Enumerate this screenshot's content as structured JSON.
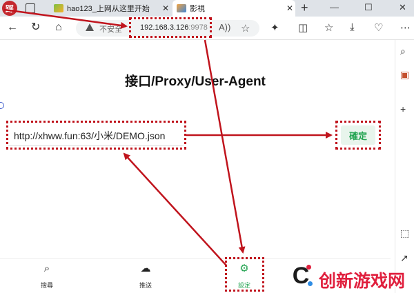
{
  "browser": {
    "tabs": [
      {
        "title": "hao123_上网从这里开始",
        "favicon": "hao123-icon"
      },
      {
        "title": "影視",
        "favicon": "tvbox-icon",
        "active": true
      }
    ],
    "profile_badge": "踩",
    "new_tab": "+",
    "window_controls": {
      "minimize": "—",
      "maximize": "☐",
      "close": "✕"
    },
    "address_bar": {
      "security_text": "不安全",
      "url_host": "192.168.3.126",
      "url_port": ":9978"
    }
  },
  "page": {
    "title": "接口/Proxy/User-Agent",
    "input_value": "http://xhww.fun:63/小米/DEMO.json",
    "confirm_label": "確定"
  },
  "bottom_nav": [
    {
      "label": "搜尋",
      "icon": "search-icon"
    },
    {
      "label": "推送",
      "icon": "cloud-upload-icon"
    },
    {
      "label": "設定",
      "icon": "gear-icon",
      "active": true
    }
  ],
  "watermark": {
    "text": "创新游戏网"
  },
  "colors": {
    "annotation": "#c0141d",
    "accent": "#22a350",
    "watermark": "#e01f3d"
  }
}
